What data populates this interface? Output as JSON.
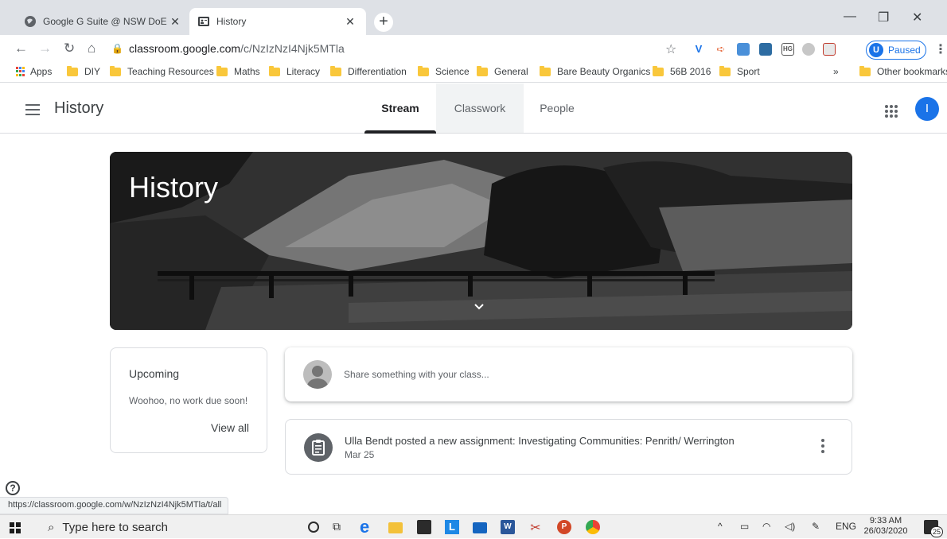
{
  "browser": {
    "tabs": [
      {
        "title": "Google G Suite @ NSW DoE",
        "active": false
      },
      {
        "title": "History",
        "active": true
      }
    ],
    "url_host": "classroom.google.com",
    "url_path": "/c/NzIzNzI4Njk5MTla",
    "profile_initial": "U",
    "profile_status": "Paused",
    "bookmarks": {
      "apps_label": "Apps",
      "folders": [
        "DIY",
        "Teaching Resources",
        "Maths",
        "Literacy",
        "Differentiation",
        "Science",
        "General",
        "Bare Beauty Organics",
        "56B 2016",
        "Sport"
      ],
      "overflow": "»",
      "other": "Other bookmarks"
    },
    "status_url": "https://classroom.google.com/w/NzIzNzI4Njk5MTla/t/all"
  },
  "classroom": {
    "class_name": "History",
    "tabs": [
      "Stream",
      "Classwork",
      "People"
    ],
    "active_tab": "Stream",
    "user_initial": "I",
    "banner_title": "History",
    "upcoming": {
      "heading": "Upcoming",
      "message": "Woohoo, no work due soon!",
      "view_all": "View all"
    },
    "share_placeholder": "Share something with your class...",
    "posts": [
      {
        "text": "Ulla Bendt posted a new assignment: Investigating Communities: Penrith/ Werrington",
        "date": "Mar 25"
      }
    ]
  },
  "taskbar": {
    "search_placeholder": "Type here to search",
    "language": "ENG",
    "time": "9:33 AM",
    "date": "26/03/2020",
    "notification_count": "25"
  },
  "colors": {
    "accent": "#1a73e8",
    "bookmark_folder": "#f9c73b"
  }
}
